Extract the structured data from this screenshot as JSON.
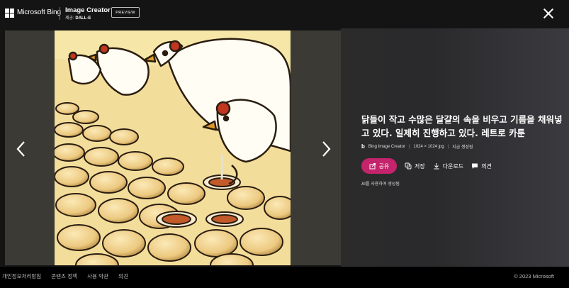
{
  "header": {
    "brand_label": "Microsoft Bing",
    "product_title": "Image Creator",
    "powered_by_prefix": "제공:",
    "powered_by_name": "DALL·E",
    "preview_badge": "PREVIEW"
  },
  "image": {
    "description": "닭들이 작고 수많은 달걀의 속을 비우고 기름을 채워넣고 있다. 일제히 진행하고 있다. 레트로 카툰"
  },
  "meta": {
    "source": "Bing Image Creator",
    "resolution": "1024 × 1024 jpg",
    "time": "지금 생성됨"
  },
  "actions": {
    "share": "공유",
    "save": "저장",
    "download": "다운로드",
    "feedback": "의견"
  },
  "ai_note": "AI를 사용하여 생성됨",
  "footer": {
    "links": [
      "개인정보처리방침",
      "콘텐츠 정책",
      "사용 약관",
      "의견"
    ],
    "copyright": "© 2023 Microsoft"
  },
  "colors": {
    "accent": "#c4246c",
    "background": "#141414",
    "footer": "#000000"
  }
}
